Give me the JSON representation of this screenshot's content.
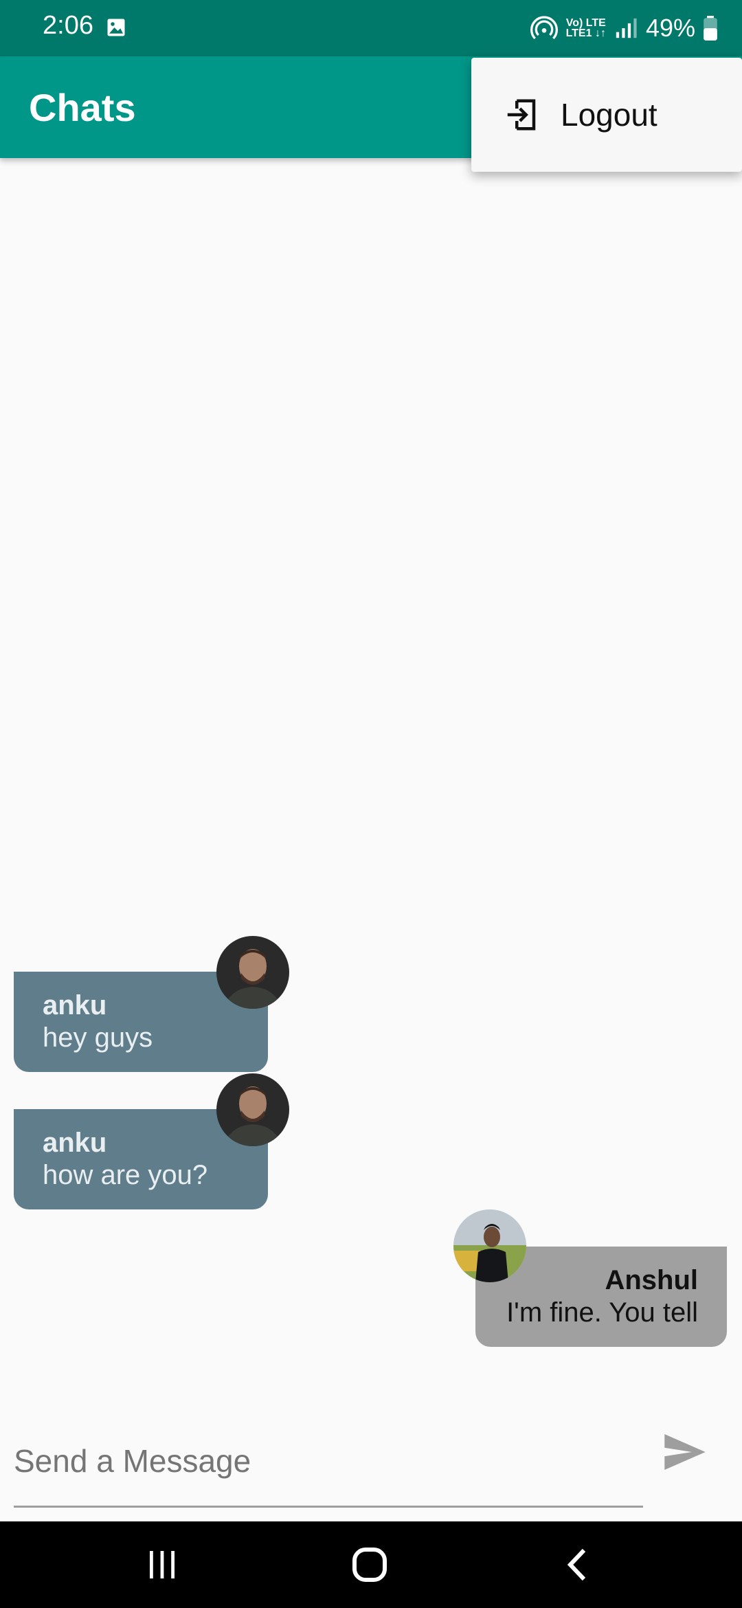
{
  "status_bar": {
    "time": "2:06",
    "network_top": "Vo) LTE",
    "network_bottom": "LTE1 ↓↑",
    "battery": "49%"
  },
  "app_bar": {
    "title": "Chats"
  },
  "menu": {
    "items": [
      {
        "label": "Logout",
        "icon": "logout-icon"
      }
    ]
  },
  "messages": [
    {
      "sender": "anku",
      "text": "hey guys",
      "side": "left"
    },
    {
      "sender": "anku",
      "text": "how are you?",
      "side": "left"
    },
    {
      "sender": "Anshul",
      "text": "I'm fine. You tell",
      "side": "right"
    }
  ],
  "composer": {
    "placeholder": "Send a Message",
    "value": ""
  },
  "colors": {
    "status_bar": "#00796b",
    "app_bar": "#009688",
    "incoming_bubble": "#607d8b",
    "outgoing_bubble": "#a0a0a0"
  }
}
